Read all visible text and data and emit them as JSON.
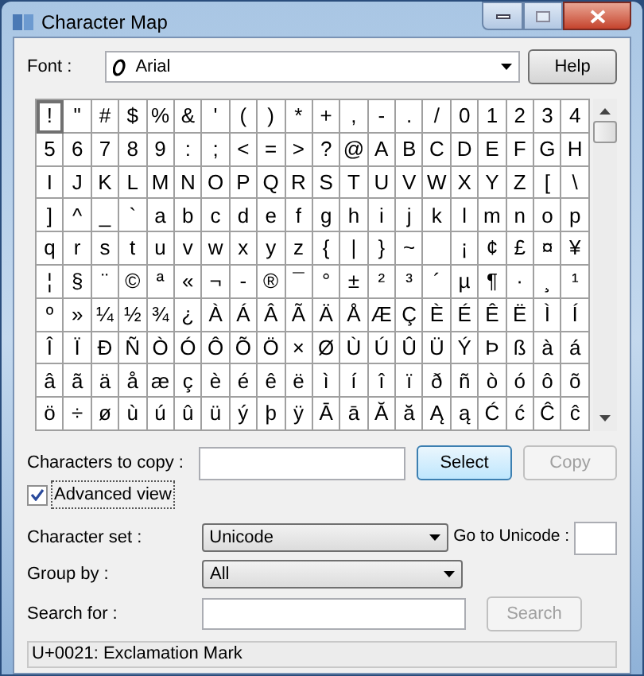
{
  "window": {
    "title": "Character Map"
  },
  "font": {
    "label": "Font :",
    "value": "Arial",
    "help_button": "Help"
  },
  "grid": {
    "rows": [
      [
        {
          "c": "!",
          "selected": true
        },
        {
          "c": "\"",
          "selected": false
        },
        {
          "c": "#",
          "selected": false
        },
        {
          "c": "$",
          "selected": false
        },
        {
          "c": "%",
          "selected": false
        },
        {
          "c": "&",
          "selected": false
        },
        {
          "c": "'",
          "selected": false
        },
        {
          "c": "(",
          "selected": false
        },
        {
          "c": ")",
          "selected": false
        },
        {
          "c": "*",
          "selected": false
        },
        {
          "c": "+",
          "selected": false
        },
        {
          "c": ",",
          "selected": false
        },
        {
          "c": "-",
          "selected": false
        },
        {
          "c": ".",
          "selected": false
        },
        {
          "c": "/",
          "selected": false
        },
        {
          "c": "0",
          "selected": false
        },
        {
          "c": "1",
          "selected": false
        },
        {
          "c": "2",
          "selected": false
        },
        {
          "c": "3",
          "selected": false
        },
        {
          "c": "4",
          "selected": false
        }
      ],
      [
        {
          "c": "5",
          "selected": false
        },
        {
          "c": "6",
          "selected": false
        },
        {
          "c": "7",
          "selected": false
        },
        {
          "c": "8",
          "selected": false
        },
        {
          "c": "9",
          "selected": false
        },
        {
          "c": ":",
          "selected": false
        },
        {
          "c": ";",
          "selected": false
        },
        {
          "c": "<",
          "selected": false
        },
        {
          "c": "=",
          "selected": false
        },
        {
          "c": ">",
          "selected": false
        },
        {
          "c": "?",
          "selected": false
        },
        {
          "c": "@",
          "selected": false
        },
        {
          "c": "A",
          "selected": false
        },
        {
          "c": "B",
          "selected": false
        },
        {
          "c": "C",
          "selected": false
        },
        {
          "c": "D",
          "selected": false
        },
        {
          "c": "E",
          "selected": false
        },
        {
          "c": "F",
          "selected": false
        },
        {
          "c": "G",
          "selected": false
        },
        {
          "c": "H",
          "selected": false
        }
      ],
      [
        {
          "c": "I",
          "selected": false
        },
        {
          "c": "J",
          "selected": false
        },
        {
          "c": "K",
          "selected": false
        },
        {
          "c": "L",
          "selected": false
        },
        {
          "c": "M",
          "selected": false
        },
        {
          "c": "N",
          "selected": false
        },
        {
          "c": "O",
          "selected": false
        },
        {
          "c": "P",
          "selected": false
        },
        {
          "c": "Q",
          "selected": false
        },
        {
          "c": "R",
          "selected": false
        },
        {
          "c": "S",
          "selected": false
        },
        {
          "c": "T",
          "selected": false
        },
        {
          "c": "U",
          "selected": false
        },
        {
          "c": "V",
          "selected": false
        },
        {
          "c": "W",
          "selected": false
        },
        {
          "c": "X",
          "selected": false
        },
        {
          "c": "Y",
          "selected": false
        },
        {
          "c": "Z",
          "selected": false
        },
        {
          "c": "[",
          "selected": false
        },
        {
          "c": "\\",
          "selected": false
        }
      ],
      [
        {
          "c": "]",
          "selected": false
        },
        {
          "c": "^",
          "selected": false
        },
        {
          "c": "_",
          "selected": false
        },
        {
          "c": "`",
          "selected": false
        },
        {
          "c": "a",
          "selected": false
        },
        {
          "c": "b",
          "selected": false
        },
        {
          "c": "c",
          "selected": false
        },
        {
          "c": "d",
          "selected": false
        },
        {
          "c": "e",
          "selected": false
        },
        {
          "c": "f",
          "selected": false
        },
        {
          "c": "g",
          "selected": false
        },
        {
          "c": "h",
          "selected": false
        },
        {
          "c": "i",
          "selected": false
        },
        {
          "c": "j",
          "selected": false
        },
        {
          "c": "k",
          "selected": false
        },
        {
          "c": "l",
          "selected": false
        },
        {
          "c": "m",
          "selected": false
        },
        {
          "c": "n",
          "selected": false
        },
        {
          "c": "o",
          "selected": false
        },
        {
          "c": "p",
          "selected": false
        }
      ],
      [
        {
          "c": "q",
          "selected": false
        },
        {
          "c": "r",
          "selected": false
        },
        {
          "c": "s",
          "selected": false
        },
        {
          "c": "t",
          "selected": false
        },
        {
          "c": "u",
          "selected": false
        },
        {
          "c": "v",
          "selected": false
        },
        {
          "c": "w",
          "selected": false
        },
        {
          "c": "x",
          "selected": false
        },
        {
          "c": "y",
          "selected": false
        },
        {
          "c": "z",
          "selected": false
        },
        {
          "c": "{",
          "selected": false
        },
        {
          "c": "|",
          "selected": false
        },
        {
          "c": "}",
          "selected": false
        },
        {
          "c": "~",
          "selected": false
        },
        {
          "selected": false
        },
        {
          "c": "¡",
          "selected": false
        },
        {
          "c": "¢",
          "selected": false
        },
        {
          "c": "£",
          "selected": false
        },
        {
          "c": "¤",
          "selected": false
        },
        {
          "c": "¥",
          "selected": false
        }
      ],
      [
        {
          "c": "¦",
          "selected": false
        },
        {
          "c": "§",
          "selected": false
        },
        {
          "c": "¨",
          "selected": false
        },
        {
          "c": "©",
          "selected": false
        },
        {
          "c": "ª",
          "selected": false
        },
        {
          "c": "«",
          "selected": false
        },
        {
          "c": "¬",
          "selected": false
        },
        {
          "c": "-",
          "selected": false
        },
        {
          "c": "®",
          "selected": false
        },
        {
          "c": "¯",
          "selected": false
        },
        {
          "c": "°",
          "selected": false
        },
        {
          "c": "±",
          "selected": false
        },
        {
          "c": "²",
          "selected": false
        },
        {
          "c": "³",
          "selected": false
        },
        {
          "c": "´",
          "selected": false
        },
        {
          "c": "µ",
          "selected": false
        },
        {
          "c": "¶",
          "selected": false
        },
        {
          "c": "·",
          "selected": false
        },
        {
          "c": "¸",
          "selected": false
        },
        {
          "c": "¹",
          "selected": false
        }
      ],
      [
        {
          "c": "º",
          "selected": false
        },
        {
          "c": "»",
          "selected": false
        },
        {
          "c": "¼",
          "selected": false
        },
        {
          "c": "½",
          "selected": false
        },
        {
          "c": "¾",
          "selected": false
        },
        {
          "c": "¿",
          "selected": false
        },
        {
          "c": "À",
          "selected": false
        },
        {
          "c": "Á",
          "selected": false
        },
        {
          "c": "Â",
          "selected": false
        },
        {
          "c": "Ã",
          "selected": false
        },
        {
          "c": "Ä",
          "selected": false
        },
        {
          "c": "Å",
          "selected": false
        },
        {
          "c": "Æ",
          "selected": false
        },
        {
          "c": "Ç",
          "selected": false
        },
        {
          "c": "È",
          "selected": false
        },
        {
          "c": "É",
          "selected": false
        },
        {
          "c": "Ê",
          "selected": false
        },
        {
          "c": "Ë",
          "selected": false
        },
        {
          "c": "Ì",
          "selected": false
        },
        {
          "c": "Í",
          "selected": false
        }
      ],
      [
        {
          "c": "Î",
          "selected": false
        },
        {
          "c": "Ï",
          "selected": false
        },
        {
          "c": "Ð",
          "selected": false
        },
        {
          "c": "Ñ",
          "selected": false
        },
        {
          "c": "Ò",
          "selected": false
        },
        {
          "c": "Ó",
          "selected": false
        },
        {
          "c": "Ô",
          "selected": false
        },
        {
          "c": "Õ",
          "selected": false
        },
        {
          "c": "Ö",
          "selected": false
        },
        {
          "c": "×",
          "selected": false
        },
        {
          "c": "Ø",
          "selected": false
        },
        {
          "c": "Ù",
          "selected": false
        },
        {
          "c": "Ú",
          "selected": false
        },
        {
          "c": "Û",
          "selected": false
        },
        {
          "c": "Ü",
          "selected": false
        },
        {
          "c": "Ý",
          "selected": false
        },
        {
          "c": "Þ",
          "selected": false
        },
        {
          "c": "ß",
          "selected": false
        },
        {
          "c": "à",
          "selected": false
        },
        {
          "c": "á",
          "selected": false
        }
      ],
      [
        {
          "c": "â",
          "selected": false
        },
        {
          "c": "ã",
          "selected": false
        },
        {
          "c": "ä",
          "selected": false
        },
        {
          "c": "å",
          "selected": false
        },
        {
          "c": "æ",
          "selected": false
        },
        {
          "c": "ç",
          "selected": false
        },
        {
          "c": "è",
          "selected": false
        },
        {
          "c": "é",
          "selected": false
        },
        {
          "c": "ê",
          "selected": false
        },
        {
          "c": "ë",
          "selected": false
        },
        {
          "c": "ì",
          "selected": false
        },
        {
          "c": "í",
          "selected": false
        },
        {
          "c": "î",
          "selected": false
        },
        {
          "c": "ï",
          "selected": false
        },
        {
          "c": "ð",
          "selected": false
        },
        {
          "c": "ñ",
          "selected": false
        },
        {
          "c": "ò",
          "selected": false
        },
        {
          "c": "ó",
          "selected": false
        },
        {
          "c": "ô",
          "selected": false
        },
        {
          "c": "õ",
          "selected": false
        }
      ],
      [
        {
          "c": "ö",
          "selected": false
        },
        {
          "c": "÷",
          "selected": false
        },
        {
          "c": "ø",
          "selected": false
        },
        {
          "c": "ù",
          "selected": false
        },
        {
          "c": "ú",
          "selected": false
        },
        {
          "c": "û",
          "selected": false
        },
        {
          "c": "ü",
          "selected": false
        },
        {
          "c": "ý",
          "selected": false
        },
        {
          "c": "þ",
          "selected": false
        },
        {
          "c": "ÿ",
          "selected": false
        },
        {
          "c": "Ā",
          "selected": false
        },
        {
          "c": "ā",
          "selected": false
        },
        {
          "c": "Ă",
          "selected": false
        },
        {
          "c": "ă",
          "selected": false
        },
        {
          "c": "Ą",
          "selected": false
        },
        {
          "c": "ą",
          "selected": false
        },
        {
          "c": "Ć",
          "selected": false
        },
        {
          "c": "ć",
          "selected": false
        },
        {
          "c": "Ĉ",
          "selected": false
        },
        {
          "c": "ĉ",
          "selected": false
        }
      ]
    ]
  },
  "copy": {
    "label": "Characters to copy :",
    "select_button": "Select",
    "copy_button": {
      "label": "Copy",
      "disabled": true
    }
  },
  "advanced_view": {
    "label": "Advanced view",
    "checked": true
  },
  "character_set": {
    "label": "Character set :",
    "value": "Unicode"
  },
  "go_to_unicode": {
    "label": "Go to Unicode :"
  },
  "group_by": {
    "label": "Group by :",
    "value": "All"
  },
  "search": {
    "label": "Search for :",
    "button": {
      "label": "Search",
      "disabled": true
    }
  },
  "status_bar": "U+0021: Exclamation Mark"
}
